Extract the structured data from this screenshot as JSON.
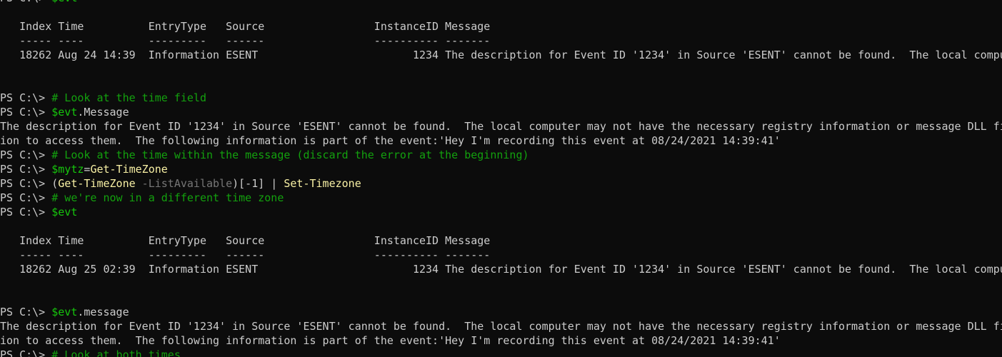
{
  "window": {
    "title": "",
    "prompt": "PS C:\\> "
  },
  "colors": {
    "background": "#0c0c0c",
    "default": "#cccccc",
    "command": "#f9f1a5",
    "variable": "#16c60c",
    "comment": "#13a10e",
    "parameter": "#767676"
  },
  "lines": [
    [
      {
        "t": "PS C:\\> "
      },
      {
        "t": "$evt",
        "c": "var"
      }
    ],
    [],
    [
      {
        "t": "   Index Time          EntryType   Source                 InstanceID Message"
      }
    ],
    [
      {
        "t": "   ----- ----          ---------   ------                 ---------- -------"
      }
    ],
    [
      {
        "t": "   18262 Aug 24 14:39  Information ESENT                        1234 The description for Event ID '1234' in Source 'ESENT' cannot be found.  The local compu"
      }
    ],
    [],
    [],
    [
      {
        "t": "PS C:\\> "
      },
      {
        "t": "# Look at the time field",
        "c": "com"
      }
    ],
    [
      {
        "t": "PS C:\\> "
      },
      {
        "t": "$evt",
        "c": "var"
      },
      {
        "t": ".Message"
      }
    ],
    [
      {
        "t": "The description for Event ID '1234' in Source 'ESENT' cannot be found.  The local computer may not have the necessary registry information or message DLL fi"
      }
    ],
    [
      {
        "t": "ion to access them.  The following information is part of the event:'Hey I'm recording this event at 08/24/2021 14:39:41'"
      }
    ],
    [
      {
        "t": "PS C:\\> "
      },
      {
        "t": "# Look at the time within the message (discard the error at the beginning)",
        "c": "com"
      }
    ],
    [
      {
        "t": "PS C:\\> "
      },
      {
        "t": "$mytz",
        "c": "var"
      },
      {
        "t": "="
      },
      {
        "t": "Get-TimeZone",
        "c": "cmd"
      }
    ],
    [
      {
        "t": "PS C:\\> "
      },
      {
        "t": "("
      },
      {
        "t": "Get-TimeZone",
        "c": "cmd"
      },
      {
        "t": " -ListAvailable",
        "c": "par"
      },
      {
        "t": ")[-1] | "
      },
      {
        "t": "Set-Timezone",
        "c": "cmd"
      }
    ],
    [
      {
        "t": "PS C:\\> "
      },
      {
        "t": "# we're now in a different time zone",
        "c": "com"
      }
    ],
    [
      {
        "t": "PS C:\\> "
      },
      {
        "t": "$evt",
        "c": "var"
      }
    ],
    [],
    [
      {
        "t": "   Index Time          EntryType   Source                 InstanceID Message"
      }
    ],
    [
      {
        "t": "   ----- ----          ---------   ------                 ---------- -------"
      }
    ],
    [
      {
        "t": "   18262 Aug 25 02:39  Information ESENT                        1234 The description for Event ID '1234' in Source 'ESENT' cannot be found.  The local compu"
      }
    ],
    [],
    [],
    [
      {
        "t": "PS C:\\> "
      },
      {
        "t": "$evt",
        "c": "var"
      },
      {
        "t": ".message"
      }
    ],
    [
      {
        "t": "The description for Event ID '1234' in Source 'ESENT' cannot be found.  The local computer may not have the necessary registry information or message DLL fi"
      }
    ],
    [
      {
        "t": "ion to access them.  The following information is part of the event:'Hey I'm recording this event at 08/24/2021 14:39:41'"
      }
    ],
    [
      {
        "t": "PS C:\\> "
      },
      {
        "t": "# Look at both times",
        "c": "com"
      }
    ]
  ]
}
